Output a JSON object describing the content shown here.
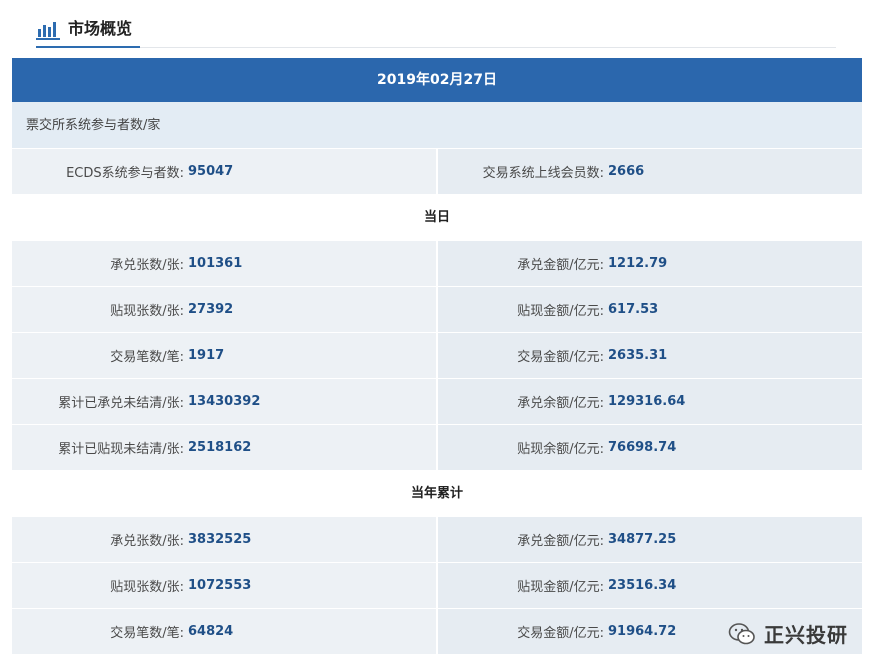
{
  "header": {
    "title": "市场概览",
    "icon": "bar-chart-icon",
    "accent_color": "#2d6cb0"
  },
  "date": "2019年02月27日",
  "participants": {
    "title": "票交所系统参与者数/家",
    "left": {
      "label": "ECDS系统参与者数:",
      "value": "95047"
    },
    "right": {
      "label": "交易系统上线会员数:",
      "value": "2666"
    }
  },
  "today": {
    "title": "当日",
    "rows": [
      {
        "left": {
          "label": "承兑张数/张:",
          "value": "101361"
        },
        "right": {
          "label": "承兑金额/亿元:",
          "value": "1212.79"
        }
      },
      {
        "left": {
          "label": "贴现张数/张:",
          "value": "27392"
        },
        "right": {
          "label": "贴现金额/亿元:",
          "value": "617.53"
        }
      },
      {
        "left": {
          "label": "交易笔数/笔:",
          "value": "1917"
        },
        "right": {
          "label": "交易金额/亿元:",
          "value": "2635.31"
        }
      },
      {
        "left": {
          "label": "累计已承兑未结清/张:",
          "value": "13430392"
        },
        "right": {
          "label": "承兑余额/亿元:",
          "value": "129316.64"
        }
      },
      {
        "left": {
          "label": "累计已贴现未结清/张:",
          "value": "2518162"
        },
        "right": {
          "label": "贴现余额/亿元:",
          "value": "76698.74"
        }
      }
    ]
  },
  "year": {
    "title": "当年累计",
    "rows": [
      {
        "left": {
          "label": "承兑张数/张:",
          "value": "3832525"
        },
        "right": {
          "label": "承兑金额/亿元:",
          "value": "34877.25"
        }
      },
      {
        "left": {
          "label": "贴现张数/张:",
          "value": "1072553"
        },
        "right": {
          "label": "贴现金额/亿元:",
          "value": "23516.34"
        }
      },
      {
        "left": {
          "label": "交易笔数/笔:",
          "value": "64824"
        },
        "right": {
          "label": "交易金额/亿元:",
          "value": "91964.72"
        }
      }
    ]
  },
  "watermark": {
    "text": "正兴投研",
    "icon": "wechat-icon"
  }
}
